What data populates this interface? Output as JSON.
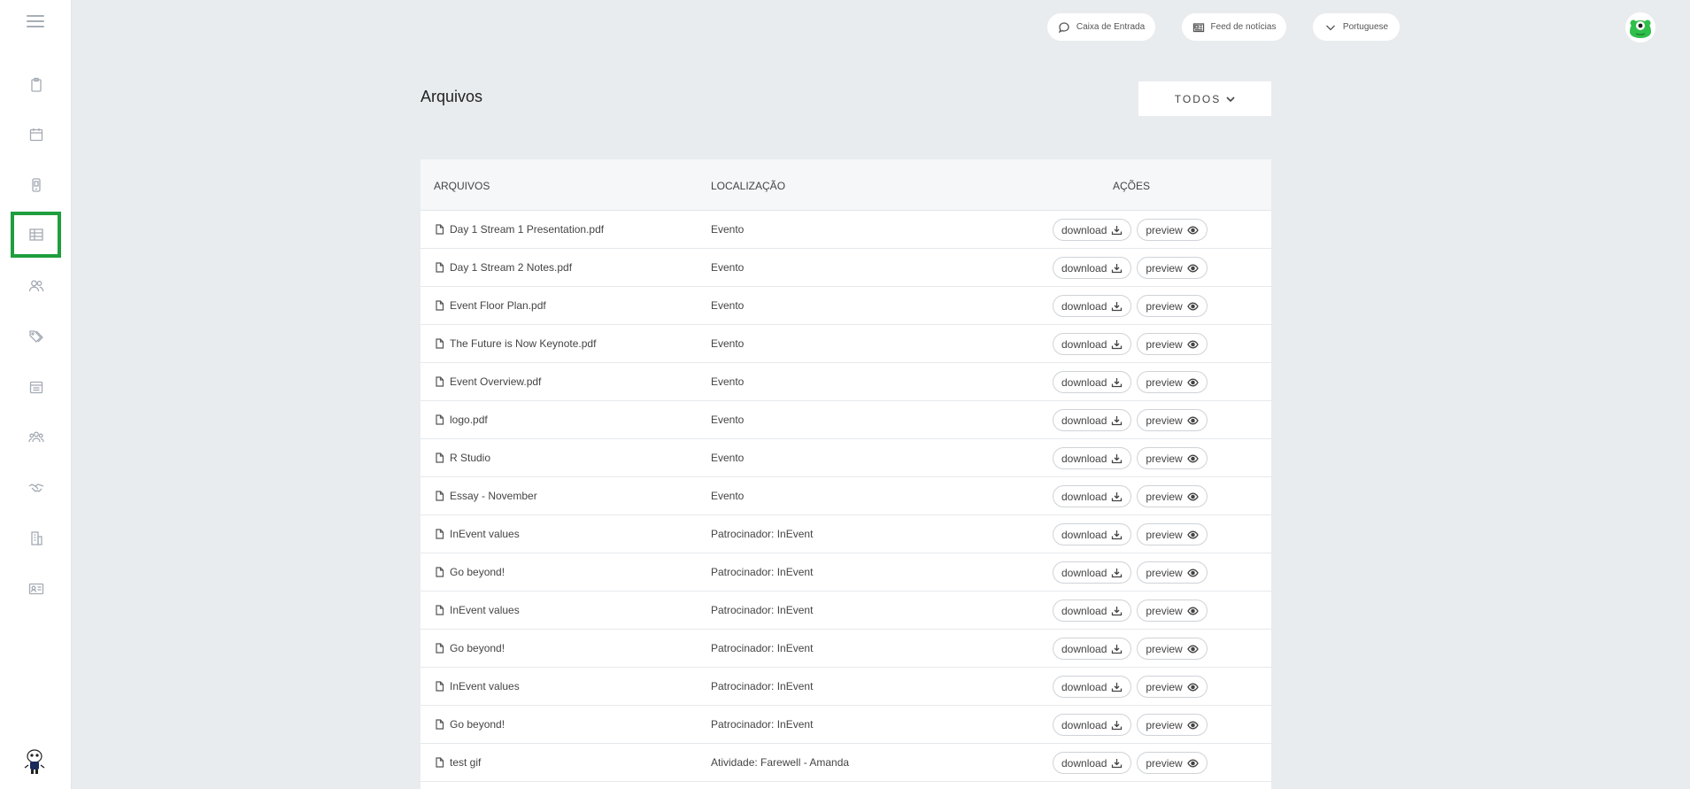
{
  "topbar": {
    "inbox_label": "Caixa de Entrada",
    "news_label": "Feed de notícias",
    "language_label": "Portuguese"
  },
  "page": {
    "title": "Arquivos",
    "filter_label": "TODOS"
  },
  "table": {
    "headers": {
      "files": "ARQUIVOS",
      "location": "LOCALIZAÇÃO",
      "actions": "AÇÕES"
    },
    "download_label": "download",
    "preview_label": "preview",
    "rows": [
      {
        "file": "Day 1 Stream 1 Presentation.pdf",
        "location": "Evento"
      },
      {
        "file": "Day 1 Stream 2 Notes.pdf",
        "location": "Evento"
      },
      {
        "file": "Event Floor Plan.pdf",
        "location": "Evento"
      },
      {
        "file": "The Future is Now Keynote.pdf",
        "location": "Evento"
      },
      {
        "file": "Event Overview.pdf",
        "location": "Evento"
      },
      {
        "file": "logo.pdf",
        "location": "Evento"
      },
      {
        "file": "R Studio",
        "location": "Evento"
      },
      {
        "file": "Essay - November",
        "location": "Evento"
      },
      {
        "file": "InEvent values",
        "location": "Patrocinador: InEvent"
      },
      {
        "file": "Go beyond!",
        "location": "Patrocinador: InEvent"
      },
      {
        "file": "InEvent values",
        "location": "Patrocinador: InEvent"
      },
      {
        "file": "Go beyond!",
        "location": "Patrocinador: InEvent"
      },
      {
        "file": "InEvent values",
        "location": "Patrocinador: InEvent"
      },
      {
        "file": "Go beyond!",
        "location": "Patrocinador: InEvent"
      },
      {
        "file": "test gif",
        "location": "Atividade: Farewell - Amanda"
      }
    ]
  },
  "sidebar": {
    "items": [
      {
        "icon": "clipboard-icon"
      },
      {
        "icon": "calendar-icon"
      },
      {
        "icon": "mobile-icon"
      },
      {
        "icon": "table-icon",
        "active": true
      },
      {
        "icon": "users-icon"
      },
      {
        "icon": "tags-icon"
      },
      {
        "icon": "agenda-icon"
      },
      {
        "icon": "group-icon"
      },
      {
        "icon": "handshake-icon"
      },
      {
        "icon": "building-icon"
      },
      {
        "icon": "id-card-icon"
      }
    ]
  },
  "colors": {
    "active_border": "#1e9e3e",
    "background": "#e9ecee"
  }
}
